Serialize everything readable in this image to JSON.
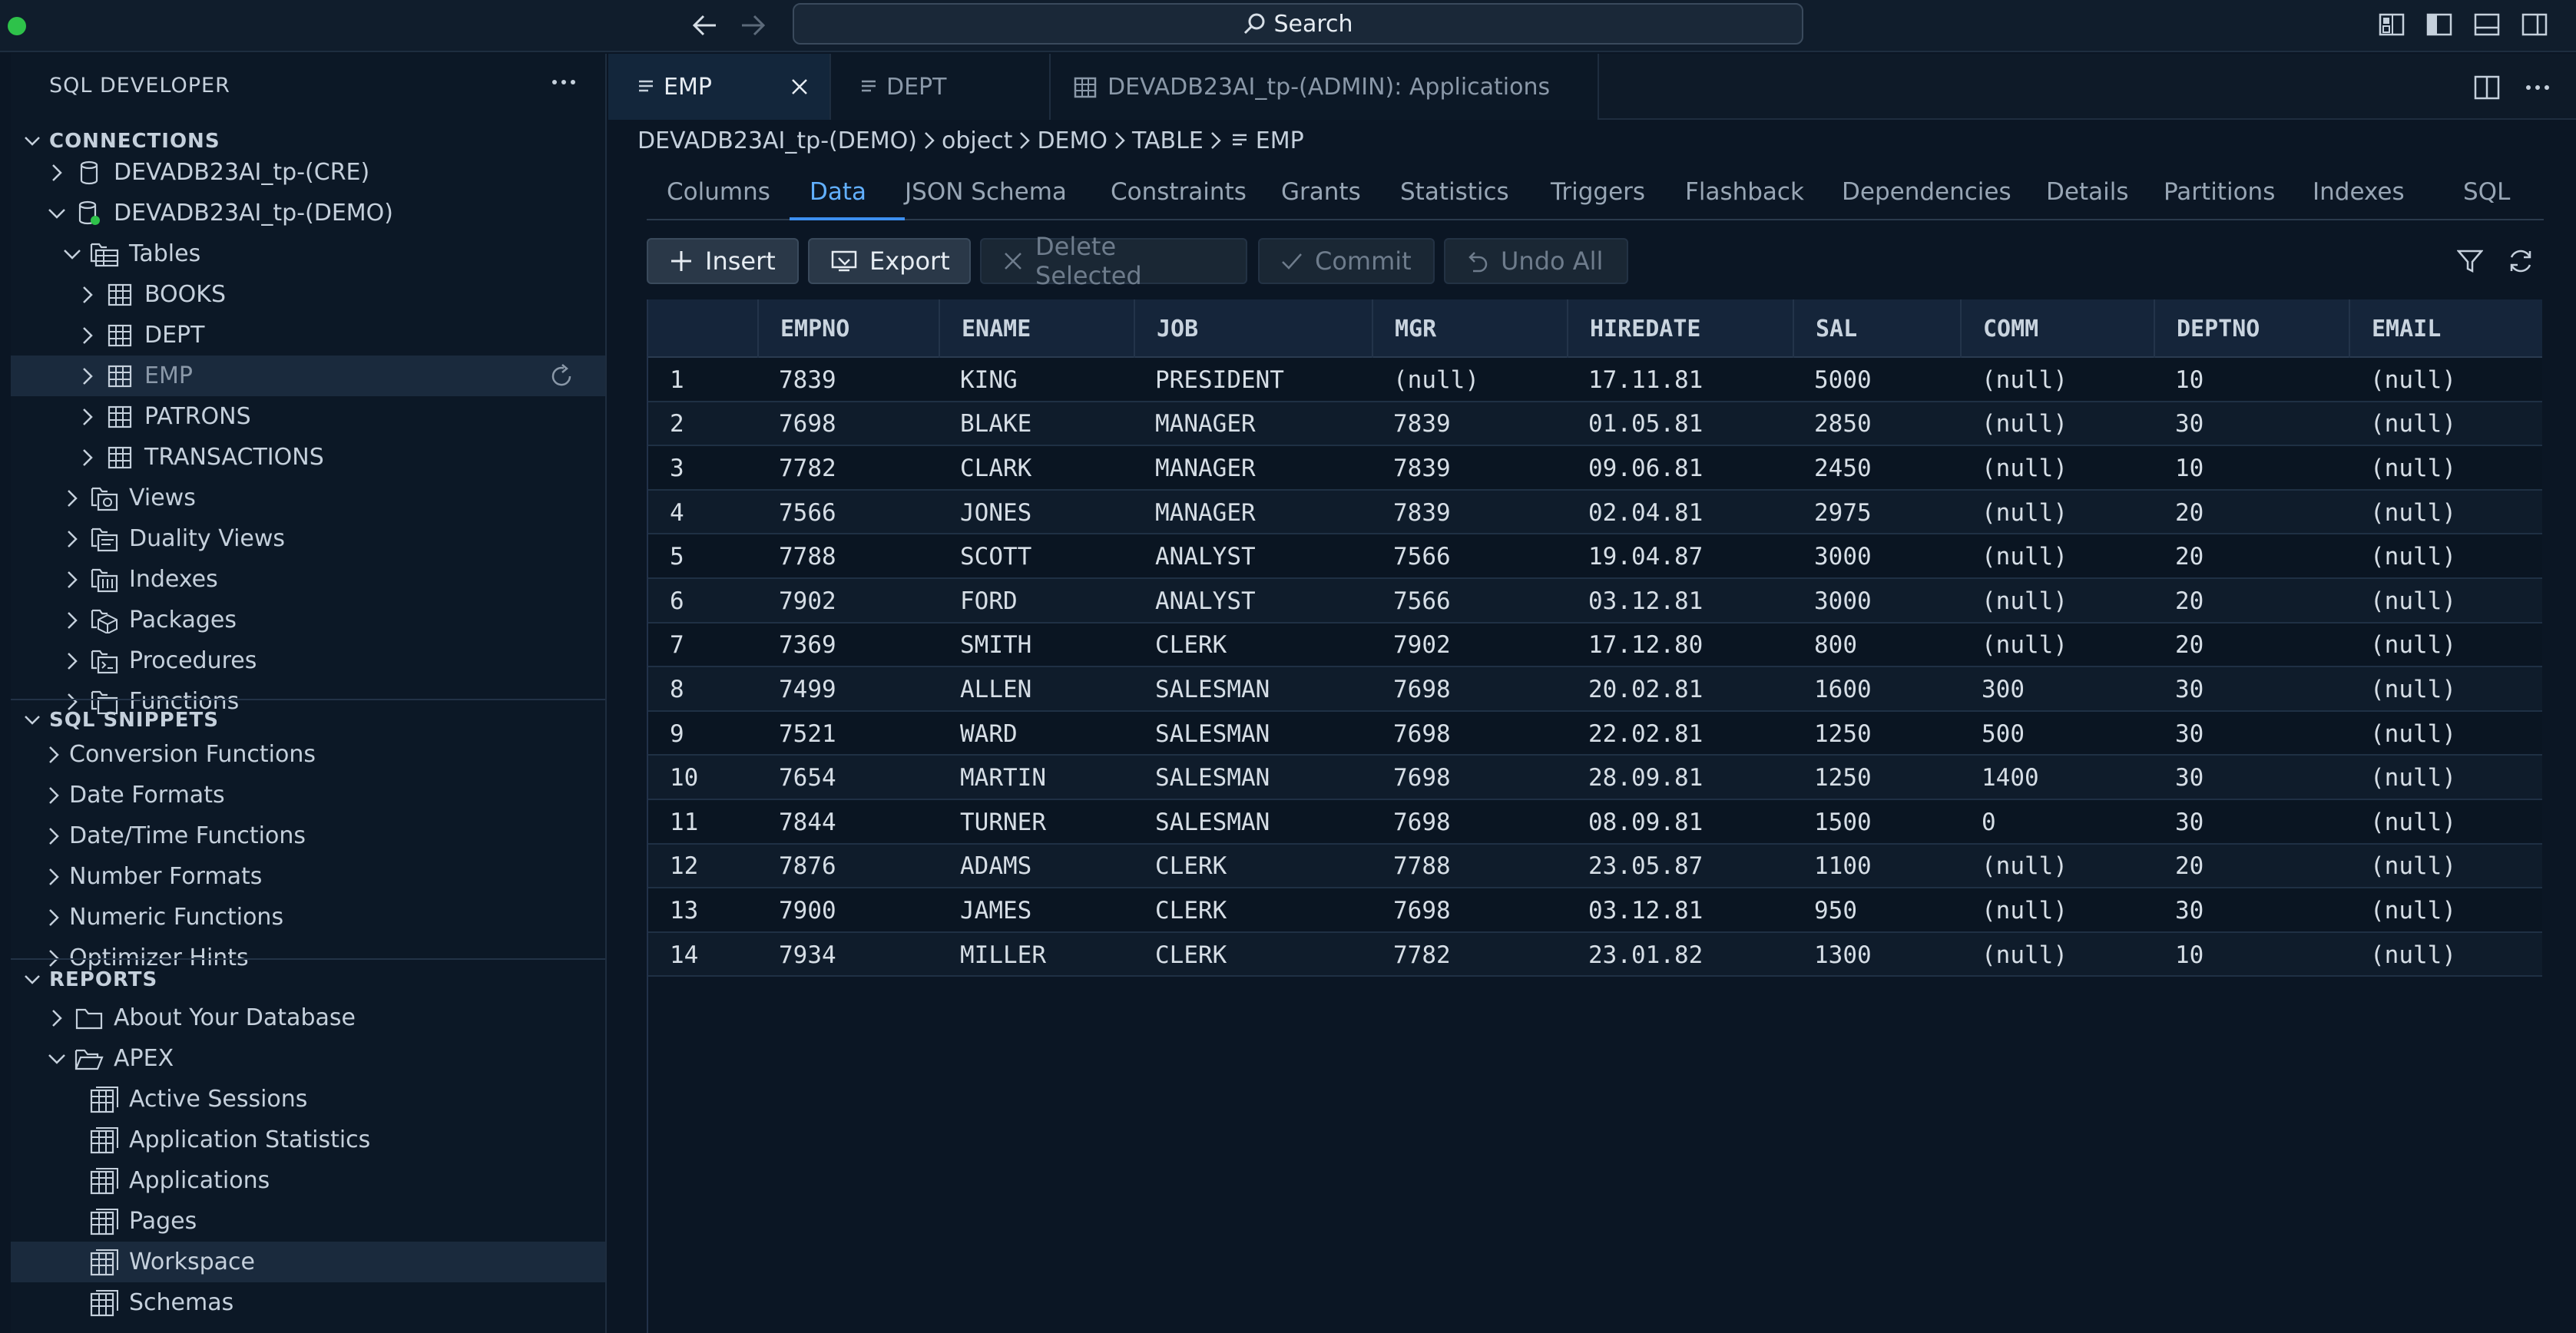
{
  "titlebar": {
    "search_label": "Search"
  },
  "sidebar": {
    "title": "SQL DEVELOPER",
    "connections": {
      "title": "CONNECTIONS",
      "items": [
        {
          "label": "DEVADB23AI_tp-(CRE)",
          "level": 0,
          "chevron": "right",
          "icon": "db-icon"
        },
        {
          "label": "DEVADB23AI_tp-(DEMO)",
          "level": 0,
          "chevron": "down",
          "icon": "db-connected-icon"
        },
        {
          "label": "Tables",
          "level": 1,
          "chevron": "down",
          "icon": "tables-folder-icon"
        },
        {
          "label": "BOOKS",
          "level": 2,
          "chevron": "right",
          "icon": "table-icon"
        },
        {
          "label": "DEPT",
          "level": 2,
          "chevron": "right",
          "icon": "table-icon"
        },
        {
          "label": "EMP",
          "level": 2,
          "chevron": "right",
          "icon": "table-icon",
          "selected": true
        },
        {
          "label": "PATRONS",
          "level": 2,
          "chevron": "right",
          "icon": "table-icon"
        },
        {
          "label": "TRANSACTIONS",
          "level": 2,
          "chevron": "right",
          "icon": "table-icon"
        },
        {
          "label": "Views",
          "level": 1,
          "chevron": "right",
          "icon": "views-icon"
        },
        {
          "label": "Duality Views",
          "level": 1,
          "chevron": "right",
          "icon": "duality-views-icon"
        },
        {
          "label": "Indexes",
          "level": 1,
          "chevron": "right",
          "icon": "indexes-icon"
        },
        {
          "label": "Packages",
          "level": 1,
          "chevron": "right",
          "icon": "packages-icon"
        },
        {
          "label": "Procedures",
          "level": 1,
          "chevron": "right",
          "icon": "procedures-icon"
        },
        {
          "label": "Functions",
          "level": 1,
          "chevron": "right",
          "icon": "functions-icon"
        }
      ]
    },
    "snippets": {
      "title": "SQL SNIPPETS",
      "items": [
        "Conversion Functions",
        "Date Formats",
        "Date/Time Functions",
        "Number Formats",
        "Numeric Functions",
        "Optimizer Hints"
      ]
    },
    "reports": {
      "title": "REPORTS",
      "items": [
        {
          "label": "About Your Database",
          "level": 0,
          "chevron": "right",
          "icon": "folder-icon"
        },
        {
          "label": "APEX",
          "level": 0,
          "chevron": "down",
          "icon": "folder-open-icon"
        },
        {
          "label": "Active Sessions",
          "level": 1,
          "icon": "report-icon"
        },
        {
          "label": "Application Statistics",
          "level": 1,
          "icon": "report-icon"
        },
        {
          "label": "Applications",
          "level": 1,
          "icon": "report-icon"
        },
        {
          "label": "Pages",
          "level": 1,
          "icon": "report-icon"
        },
        {
          "label": "Workspace",
          "level": 1,
          "icon": "report-icon",
          "selected": true
        },
        {
          "label": "Schemas",
          "level": 1,
          "icon": "report-icon"
        }
      ]
    }
  },
  "editor_tabs": [
    {
      "label": "EMP",
      "active": true,
      "icon": "table-doc-icon",
      "closable": true
    },
    {
      "label": "DEPT",
      "active": false,
      "icon": "table-doc-icon"
    },
    {
      "label": "DEVADB23AI_tp-(ADMIN): Applications",
      "active": false,
      "icon": "report-icon"
    }
  ],
  "breadcrumb": [
    "DEVADB23AI_tp-(DEMO)",
    "object",
    "DEMO",
    "TABLE",
    "EMP"
  ],
  "object_tabs": {
    "items": [
      "Columns",
      "Data",
      "JSON Schema",
      "Constraints",
      "Grants",
      "Statistics",
      "Triggers",
      "Flashback",
      "Dependencies",
      "Details",
      "Partitions",
      "Indexes",
      "SQL"
    ],
    "active": "Data"
  },
  "toolbar": {
    "insert": "Insert",
    "export": "Export",
    "delete_selected": "Delete Selected",
    "commit": "Commit",
    "undo_all": "Undo All"
  },
  "grid": {
    "columns": [
      "",
      "EMPNO",
      "ENAME",
      "JOB",
      "MGR",
      "HIREDATE",
      "SAL",
      "COMM",
      "DEPTNO",
      "EMAIL"
    ],
    "rows": [
      [
        "1",
        "7839",
        "KING",
        "PRESIDENT",
        "(null)",
        "17.11.81",
        "5000",
        "(null)",
        "10",
        "(null)"
      ],
      [
        "2",
        "7698",
        "BLAKE",
        "MANAGER",
        "7839",
        "01.05.81",
        "2850",
        "(null)",
        "30",
        "(null)"
      ],
      [
        "3",
        "7782",
        "CLARK",
        "MANAGER",
        "7839",
        "09.06.81",
        "2450",
        "(null)",
        "10",
        "(null)"
      ],
      [
        "4",
        "7566",
        "JONES",
        "MANAGER",
        "7839",
        "02.04.81",
        "2975",
        "(null)",
        "20",
        "(null)"
      ],
      [
        "5",
        "7788",
        "SCOTT",
        "ANALYST",
        "7566",
        "19.04.87",
        "3000",
        "(null)",
        "20",
        "(null)"
      ],
      [
        "6",
        "7902",
        "FORD",
        "ANALYST",
        "7566",
        "03.12.81",
        "3000",
        "(null)",
        "20",
        "(null)"
      ],
      [
        "7",
        "7369",
        "SMITH",
        "CLERK",
        "7902",
        "17.12.80",
        "800",
        "(null)",
        "20",
        "(null)"
      ],
      [
        "8",
        "7499",
        "ALLEN",
        "SALESMAN",
        "7698",
        "20.02.81",
        "1600",
        "300",
        "30",
        "(null)"
      ],
      [
        "9",
        "7521",
        "WARD",
        "SALESMAN",
        "7698",
        "22.02.81",
        "1250",
        "500",
        "30",
        "(null)"
      ],
      [
        "10",
        "7654",
        "MARTIN",
        "SALESMAN",
        "7698",
        "28.09.81",
        "1250",
        "1400",
        "30",
        "(null)"
      ],
      [
        "11",
        "7844",
        "TURNER",
        "SALESMAN",
        "7698",
        "08.09.81",
        "1500",
        "0",
        "30",
        "(null)"
      ],
      [
        "12",
        "7876",
        "ADAMS",
        "CLERK",
        "7788",
        "23.05.87",
        "1100",
        "(null)",
        "20",
        "(null)"
      ],
      [
        "13",
        "7900",
        "JAMES",
        "CLERK",
        "7698",
        "03.12.81",
        "950",
        "(null)",
        "30",
        "(null)"
      ],
      [
        "14",
        "7934",
        "MILLER",
        "CLERK",
        "7782",
        "23.01.82",
        "1300",
        "(null)",
        "10",
        "(null)"
      ]
    ]
  },
  "colors": {
    "accent": "#3d8ff0",
    "background": "#0b1624",
    "traffic_light": "#2ec24a"
  }
}
